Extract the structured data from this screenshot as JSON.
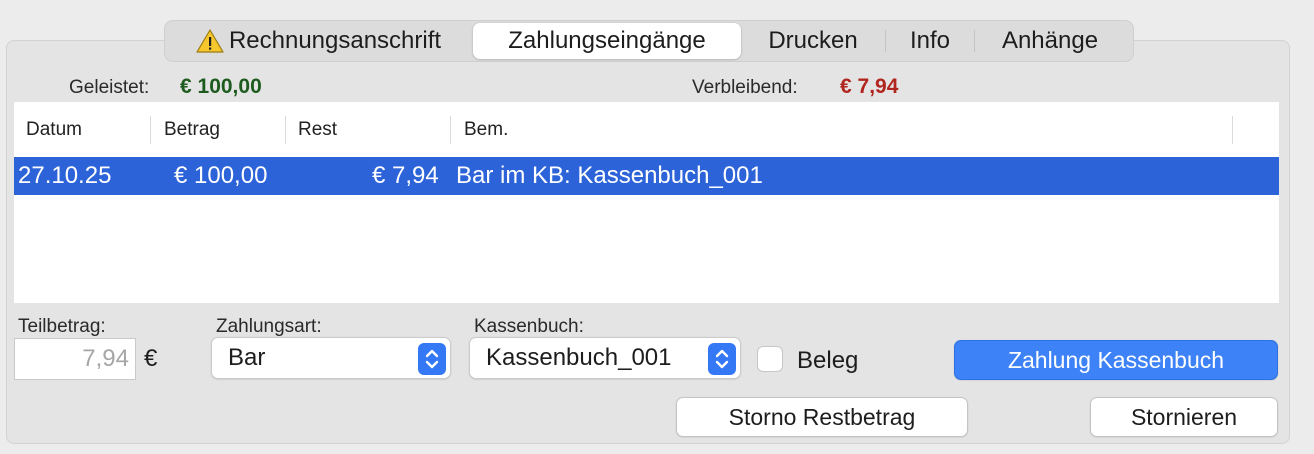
{
  "tabs": [
    {
      "label": "Rechnungsanschrift",
      "icon": "warning-icon",
      "active": false
    },
    {
      "label": "Zahlungseingänge",
      "active": true
    },
    {
      "label": "Drucken",
      "active": false
    },
    {
      "label": "Info",
      "active": false
    },
    {
      "label": "Anhänge",
      "active": false
    }
  ],
  "summary": {
    "paid_label": "Geleistet:",
    "paid_value": "€ 100,00",
    "paid_color": "#1e5b1e",
    "remaining_label": "Verbleibend:",
    "remaining_value": "€ 7,94",
    "remaining_color": "#b0261f"
  },
  "table": {
    "columns": [
      "Datum",
      "Betrag",
      "Rest",
      "Bem."
    ],
    "rows": [
      {
        "datum": "27.10.25",
        "betrag": "€ 100,00",
        "rest": "€ 7,94",
        "bem": "Bar im KB: Kassenbuch_001",
        "selected": true
      }
    ],
    "selection_color": "#2d63d8"
  },
  "form": {
    "teilbetrag_label": "Teilbetrag:",
    "teilbetrag_value": "7,94",
    "currency": "€",
    "zahlungsart_label": "Zahlungsart:",
    "zahlungsart_value": "Bar",
    "kassenbuch_label": "Kassenbuch:",
    "kassenbuch_value": "Kassenbuch_001",
    "beleg_label": "Beleg",
    "beleg_checked": false
  },
  "buttons": {
    "zahlung_kassenbuch": "Zahlung Kassenbuch",
    "storno_restbetrag": "Storno Restbetrag",
    "stornieren": "Stornieren"
  }
}
